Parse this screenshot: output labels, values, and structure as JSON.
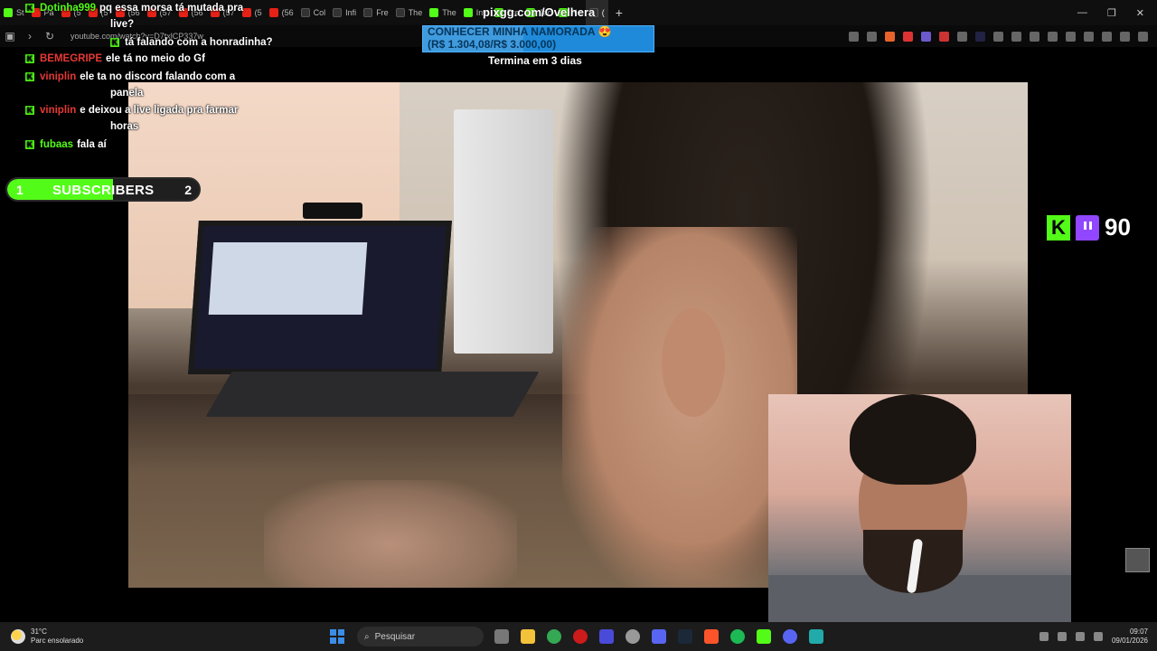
{
  "browser": {
    "tabs": [
      {
        "label": "St",
        "icon": "kick"
      },
      {
        "label": "Pa",
        "icon": "youtube"
      },
      {
        "label": "(5",
        "icon": "youtube"
      },
      {
        "label": "(5",
        "icon": "youtube"
      },
      {
        "label": "(56",
        "icon": "youtube"
      },
      {
        "label": "(57",
        "icon": "youtube"
      },
      {
        "label": "(56",
        "icon": "youtube"
      },
      {
        "label": "(57",
        "icon": "youtube"
      },
      {
        "label": "(5",
        "icon": "youtube"
      },
      {
        "label": "(56",
        "icon": "youtube"
      },
      {
        "label": "Col",
        "icon": "dark"
      },
      {
        "label": "Infi",
        "icon": "dark"
      },
      {
        "label": "Fre",
        "icon": "dark"
      },
      {
        "label": "The",
        "icon": "dark"
      },
      {
        "label": "The",
        "icon": "kick"
      },
      {
        "label": "Inv",
        "icon": "kick"
      },
      {
        "label": "Fre",
        "icon": "kick"
      },
      {
        "label": "Jac",
        "icon": "kick"
      },
      {
        "label": "He",
        "icon": "kick"
      },
      {
        "label": "(",
        "icon": "dark",
        "active": true
      }
    ],
    "new_tab": "+",
    "window_controls": {
      "minimize": "—",
      "restore": "❐",
      "close": "✕"
    },
    "url": "youtube.com/watch?v=D7txlCP337w"
  },
  "overlay": {
    "pix_link": "pixgg.com/Ovelhera",
    "goal_title": "CONHECER MINHA NAMORADA 😍",
    "goal_amount": "(R$ 1.304,08/R$ 3.000,00)",
    "goal_progress": 0.4347,
    "ends_text": "Termina em 3 dias",
    "subs_label": "SUBSCRIBERS",
    "subs_start": "1",
    "subs_end": "2",
    "subs_progress": 0.55,
    "viewer_count": "90",
    "kick_logo": "K"
  },
  "chat": [
    {
      "user": "Dotinha999",
      "color": "#53fc18",
      "message": "pq essa morsa tá mutada pra",
      "badge": true
    },
    {
      "user": "",
      "color": "#ffffff",
      "message": "live?",
      "badge": false
    },
    {
      "user": "",
      "color": "#e53935",
      "message": "tá falando com a honradinha?",
      "badge": true
    },
    {
      "user": "BEMEGRIPE",
      "color": "#e53935",
      "message": "ele tá no meio do Gf",
      "badge": true
    },
    {
      "user": "viniplin",
      "color": "#e53935",
      "message": "ele ta no discord falando com a",
      "badge": true
    },
    {
      "user": "",
      "color": "#ffffff",
      "message": "panela",
      "badge": false
    },
    {
      "user": "viniplin",
      "color": "#e53935",
      "message": "e deixou a live ligada pra farmar",
      "badge": true
    },
    {
      "user": "",
      "color": "#ffffff",
      "message": "horas",
      "badge": false
    },
    {
      "user": "fubaas",
      "color": "#53fc18",
      "message": "fala aí",
      "badge": true
    }
  ],
  "taskbar": {
    "weather_temp": "31°C",
    "weather_desc": "Parc ensolarado",
    "search_placeholder": "Pesquisar",
    "time": "09:07",
    "date": "09/01/2026"
  }
}
